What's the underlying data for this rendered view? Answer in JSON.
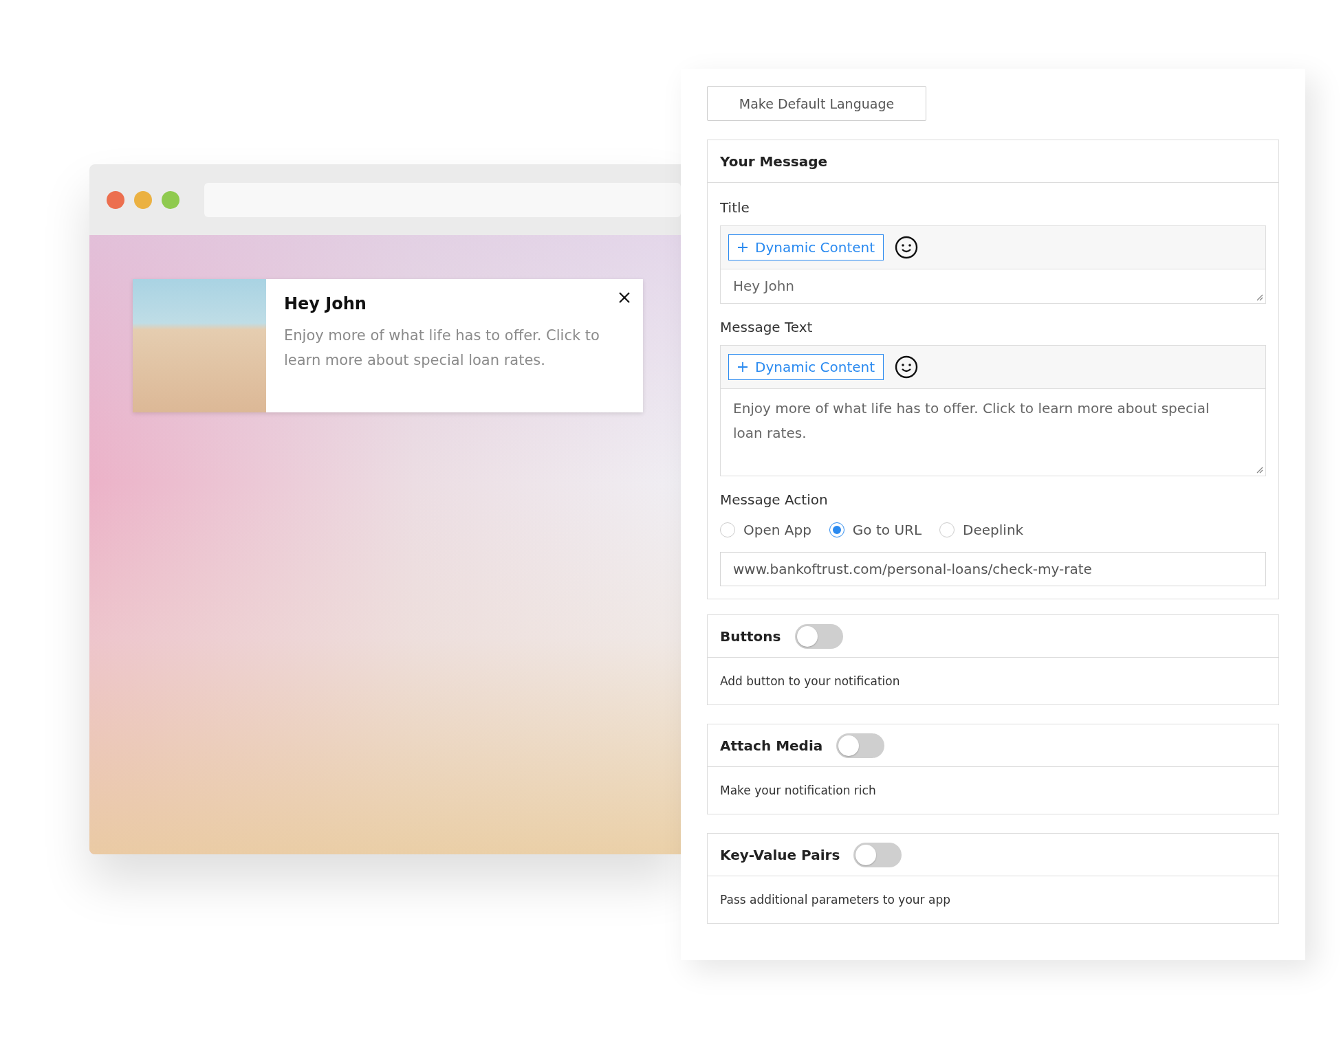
{
  "preview": {
    "notification": {
      "title": "Hey John",
      "body": "Enjoy more of what life has to offer. Click to learn more about special loan rates."
    }
  },
  "editor": {
    "default_language_button": "Make Default Language",
    "message_card": {
      "heading": "Your Message",
      "fields": [
        {
          "kind": "single",
          "label": "Title",
          "dynamic_button": "Dynamic Content",
          "value": "Hey John"
        },
        {
          "kind": "multi",
          "label": "Message Text",
          "dynamic_button": "Dynamic Content",
          "value": "Enjoy more of what life has to offer. Click to learn more about special loan rates."
        }
      ],
      "action": {
        "label": "Message Action",
        "options": [
          {
            "label": "Open App",
            "selected": false
          },
          {
            "label": "Go to URL",
            "selected": true
          },
          {
            "label": "Deeplink",
            "selected": false
          }
        ],
        "url": "www.bankoftrust.com/personal-loans/check-my-rate"
      }
    },
    "sections": [
      {
        "title": "Buttons",
        "on": false,
        "description": "Add button to your notification"
      },
      {
        "title": "Attach Media",
        "on": false,
        "description": "Make your notification rich"
      },
      {
        "title": "Key-Value Pairs",
        "on": false,
        "description": "Pass additional parameters to your app"
      }
    ]
  }
}
